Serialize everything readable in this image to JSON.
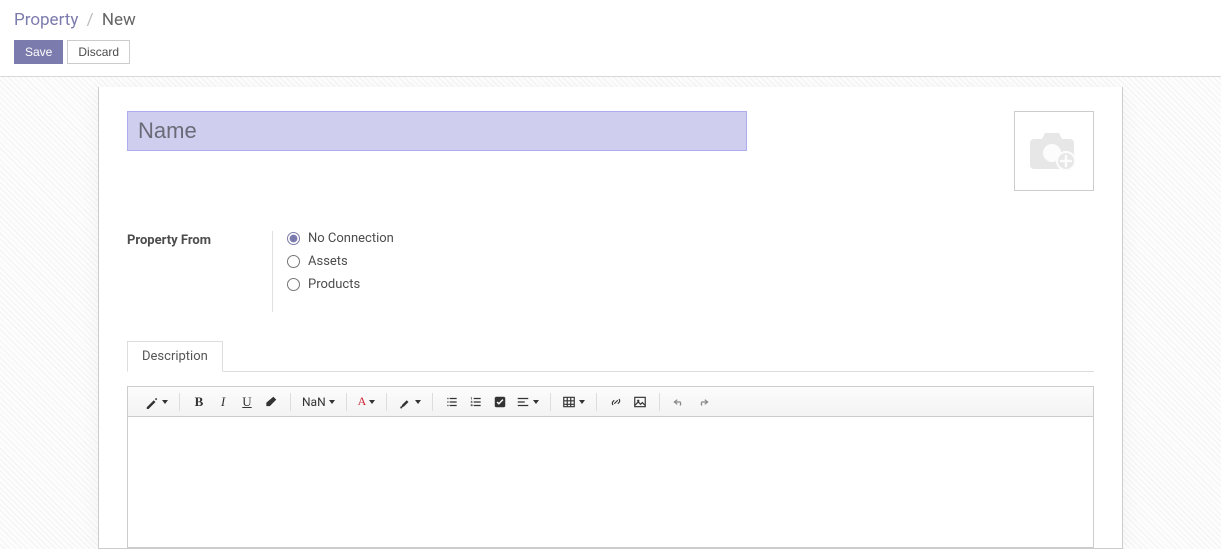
{
  "breadcrumb": {
    "root": "Property",
    "separator": "/",
    "current": "New"
  },
  "actions": {
    "save": "Save",
    "discard": "Discard"
  },
  "form": {
    "name_placeholder": "Name",
    "name_value": "",
    "property_from_label": "Property From",
    "property_from_options": {
      "none": "No Connection",
      "assets": "Assets",
      "products": "Products"
    },
    "property_from_selected": "none"
  },
  "tabs": {
    "description": "Description"
  },
  "editor_toolbar": {
    "font_size_display": "NaN",
    "font_family_display": "A"
  }
}
